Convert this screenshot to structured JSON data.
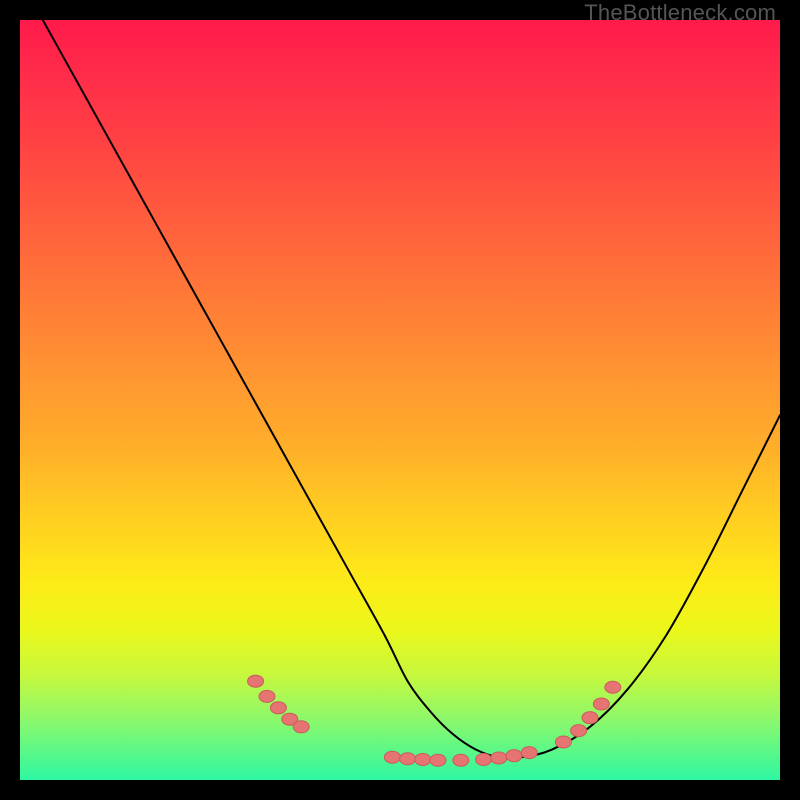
{
  "watermark": "TheBottleneck.com",
  "colors": {
    "background": "#000000",
    "curve": "#000000",
    "marker": "#e67472",
    "marker_stroke": "#cc5a5c"
  },
  "chart_data": {
    "type": "line",
    "title": "",
    "xlabel": "",
    "ylabel": "",
    "xlim": [
      0,
      100
    ],
    "ylim": [
      0,
      100
    ],
    "grid": false,
    "legend": false,
    "series": [
      {
        "name": "bottleneck-curve",
        "x": [
          3,
          8,
          13,
          18,
          23,
          28,
          33,
          38,
          43,
          48,
          51,
          54,
          57,
          60,
          63,
          66,
          70,
          75,
          80,
          85,
          90,
          95,
          100
        ],
        "y": [
          100,
          91,
          82,
          73,
          64,
          55,
          46,
          37,
          28,
          19,
          13,
          9,
          6,
          4,
          3,
          3,
          4,
          7,
          12,
          19,
          28,
          38,
          48
        ]
      }
    ],
    "markers": [
      {
        "x": 31.0,
        "y": 13.0
      },
      {
        "x": 32.5,
        "y": 11.0
      },
      {
        "x": 34.0,
        "y": 9.5
      },
      {
        "x": 35.5,
        "y": 8.0
      },
      {
        "x": 37.0,
        "y": 7.0
      },
      {
        "x": 49.0,
        "y": 3.0
      },
      {
        "x": 51.0,
        "y": 2.8
      },
      {
        "x": 53.0,
        "y": 2.7
      },
      {
        "x": 55.0,
        "y": 2.6
      },
      {
        "x": 58.0,
        "y": 2.6
      },
      {
        "x": 61.0,
        "y": 2.7
      },
      {
        "x": 63.0,
        "y": 2.9
      },
      {
        "x": 65.0,
        "y": 3.2
      },
      {
        "x": 67.0,
        "y": 3.6
      },
      {
        "x": 71.5,
        "y": 5.0
      },
      {
        "x": 73.5,
        "y": 6.5
      },
      {
        "x": 75.0,
        "y": 8.2
      },
      {
        "x": 76.5,
        "y": 10.0
      },
      {
        "x": 78.0,
        "y": 12.2
      }
    ]
  }
}
